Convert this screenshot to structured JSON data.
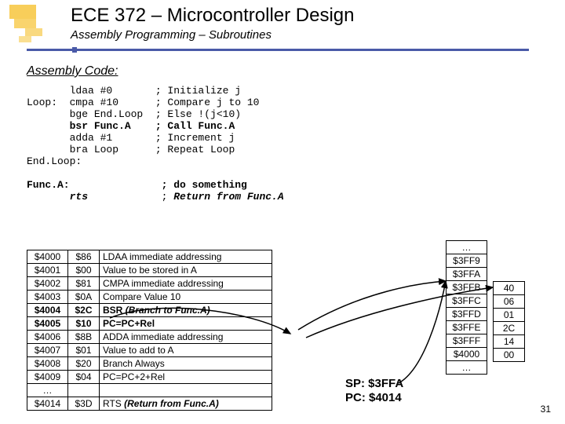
{
  "header": {
    "title": "ECE 372 – Microcontroller Design",
    "subtitle": "Assembly Programming – Subroutines"
  },
  "section_heading": "Assembly Code:",
  "code": {
    "l1_a": "       ldaa #0       ; Initialize j",
    "l2_a": "Loop:  cmpa #10      ; Compare j to 10",
    "l3_a": "       bge End.Loop  ; Else !(j<10)",
    "l4_b": "       bsr Func.A    ; Call Func.A",
    "l5_a": "       adda #1       ; Increment j",
    "l6_a": "       bra Loop      ; Repeat Loop",
    "l7_a": "End.Loop:",
    "blank": " ",
    "l8_b": "Func.A:               ; do something",
    "l9_p": "       ",
    "l9_bi": "rts",
    "l9_s": "            ; ",
    "l9_bi2": "Return from Func.A"
  },
  "main_table": [
    {
      "addr": "$4000",
      "val": "$86",
      "desc": "LDAA immediate addressing",
      "bold": false
    },
    {
      "addr": "$4001",
      "val": "$00",
      "desc": "Value to be stored in A",
      "bold": false
    },
    {
      "addr": "$4002",
      "val": "$81",
      "desc": "CMPA immediate addressing",
      "bold": false
    },
    {
      "addr": "$4003",
      "val": "$0A",
      "desc": "Compare Value 10",
      "bold": false
    },
    {
      "addr": "$4004",
      "val": "$2C",
      "desc_html": true,
      "p1": "BSR ",
      "p2": "(Branch to Func.A)",
      "bold": true
    },
    {
      "addr": "$4005",
      "val": "$10",
      "desc": "PC=PC+Rel",
      "bold": true
    },
    {
      "addr": "$4006",
      "val": "$8B",
      "desc": "ADDA immediate addressing",
      "bold": false
    },
    {
      "addr": "$4007",
      "val": "$01",
      "desc": "Value to add to A",
      "bold": false
    },
    {
      "addr": "$4008",
      "val": "$20",
      "desc": "Branch Always",
      "bold": false
    },
    {
      "addr": "$4009",
      "val": "$04",
      "desc": "PC=PC+2+Rel",
      "bold": false
    },
    {
      "addr": "…",
      "val": "",
      "desc": "",
      "bold": false
    },
    {
      "addr": "$4014",
      "val": "$3D",
      "desc_html": true,
      "p1": "RTS ",
      "p2": "(Return from Func.A)",
      "bold": false
    }
  ],
  "stack_addr": [
    "…",
    "$3FF9",
    "$3FFA",
    "$3FFB",
    "$3FFC",
    "$3FFD",
    "$3FFE",
    "$3FFF",
    "$4000",
    "…"
  ],
  "stack_val": [
    "40",
    "06",
    "01",
    "2C",
    "14",
    "00"
  ],
  "registers": {
    "sp": "SP: $3FFA",
    "pc": "PC: $4014"
  },
  "page_number": "31"
}
